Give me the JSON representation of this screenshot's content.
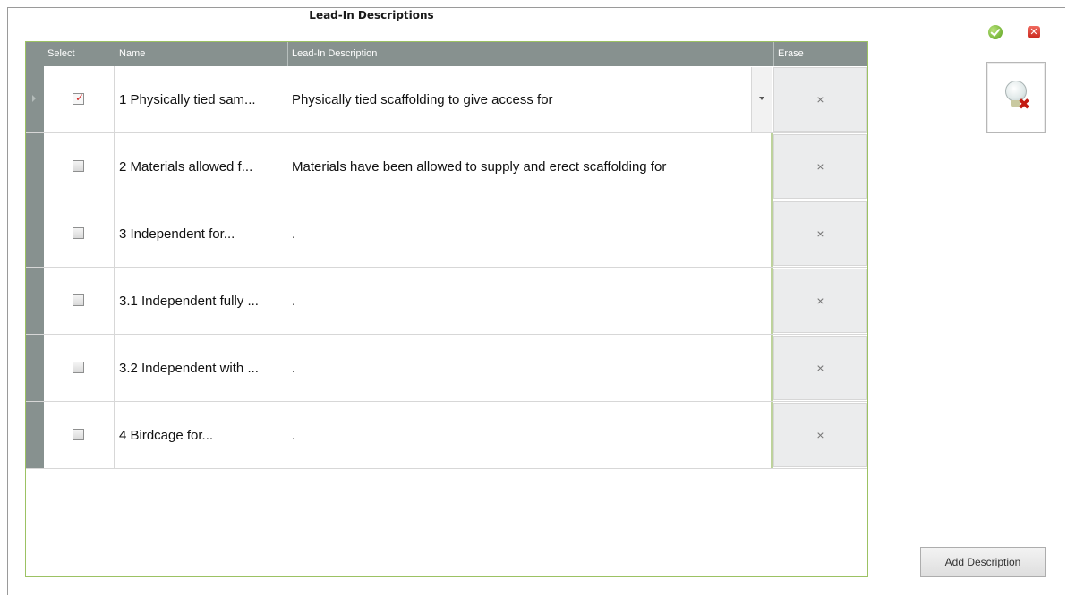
{
  "window": {
    "title": "Lead-In Descriptions"
  },
  "grid": {
    "columns": {
      "select": "Select",
      "name": "Name",
      "description": "Lead-In Description",
      "erase": "Erase"
    },
    "rows": [
      {
        "checked": true,
        "name": "1 Physically tied sam...",
        "description": "Physically tied scaffolding to give access for",
        "erase": "×"
      },
      {
        "checked": false,
        "name": "2 Materials allowed f...",
        "description": "Materials have been allowed to supply and erect scaffolding for",
        "erase": "×"
      },
      {
        "checked": false,
        "name": "3 Independent for...",
        "description": ".",
        "erase": "×"
      },
      {
        "checked": false,
        "name": "3.1 Independent fully ...",
        "description": ".",
        "erase": "×"
      },
      {
        "checked": false,
        "name": "3.2 Independent with ...",
        "description": ".",
        "erase": "×"
      },
      {
        "checked": false,
        "name": "4 Birdcage for...",
        "description": ".",
        "erase": "×"
      }
    ]
  },
  "toolbar": {
    "ok_icon": "check-circle",
    "close_icon": "x-square",
    "close_glyph": "✕"
  },
  "hint": {
    "icon": "lightbulb-remove",
    "x_glyph": "✖"
  },
  "add_button": {
    "label": "Add Description"
  },
  "colors": {
    "header_bg": "#87918f",
    "grid_border": "#9cc263",
    "check_mark": "#d62a2a"
  }
}
